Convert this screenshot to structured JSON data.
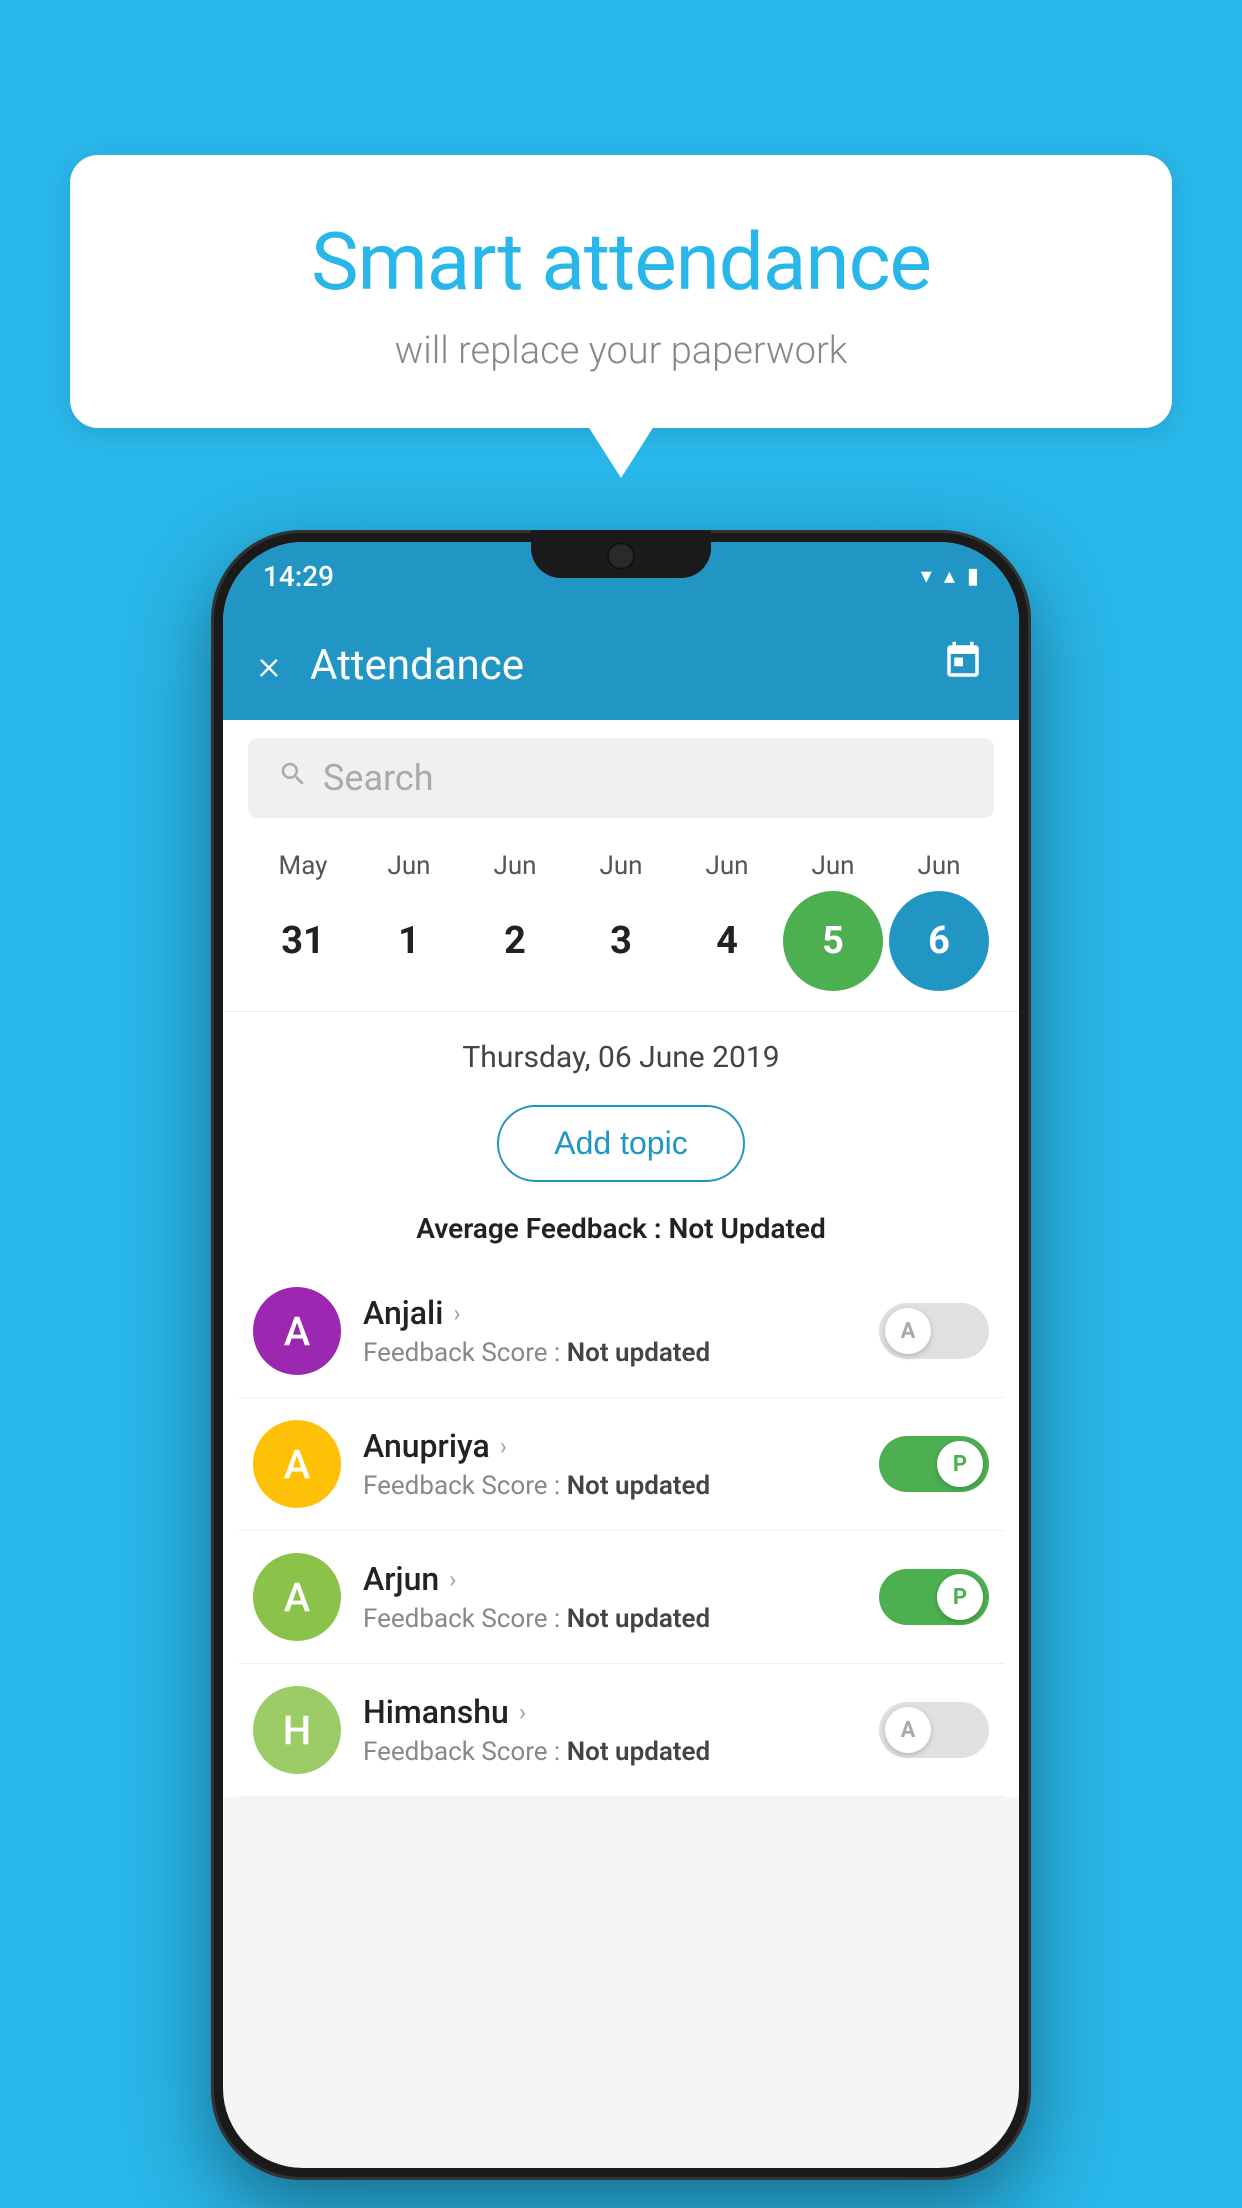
{
  "page": {
    "background_color": "#29b6e8"
  },
  "speech_bubble": {
    "headline": "Smart attendance",
    "subtext": "will replace your paperwork"
  },
  "status_bar": {
    "time": "14:29",
    "wifi_icon": "▼",
    "signal_icon": "▲",
    "battery_icon": "▮"
  },
  "app_bar": {
    "title": "Attendance",
    "close_label": "×",
    "calendar_icon": "📅"
  },
  "search": {
    "placeholder": "Search"
  },
  "calendar": {
    "dates": [
      {
        "month": "May",
        "day": "31",
        "state": "normal"
      },
      {
        "month": "Jun",
        "day": "1",
        "state": "normal"
      },
      {
        "month": "Jun",
        "day": "2",
        "state": "normal"
      },
      {
        "month": "Jun",
        "day": "3",
        "state": "normal"
      },
      {
        "month": "Jun",
        "day": "4",
        "state": "normal"
      },
      {
        "month": "Jun",
        "day": "5",
        "state": "today"
      },
      {
        "month": "Jun",
        "day": "6",
        "state": "selected"
      }
    ]
  },
  "selected_date": "Thursday, 06 June 2019",
  "add_topic_label": "Add topic",
  "avg_feedback": {
    "label": "Average Feedback : ",
    "value": "Not Updated"
  },
  "students": [
    {
      "name": "Anjali",
      "avatar_letter": "A",
      "avatar_color": "#9c27b0",
      "feedback_label": "Feedback Score : ",
      "feedback_value": "Not updated",
      "toggle_state": "off",
      "toggle_label": "A"
    },
    {
      "name": "Anupriya",
      "avatar_letter": "A",
      "avatar_color": "#ffc107",
      "feedback_label": "Feedback Score : ",
      "feedback_value": "Not updated",
      "toggle_state": "on",
      "toggle_label": "P"
    },
    {
      "name": "Arjun",
      "avatar_letter": "A",
      "avatar_color": "#8bc34a",
      "feedback_label": "Feedback Score : ",
      "feedback_value": "Not updated",
      "toggle_state": "on",
      "toggle_label": "P"
    },
    {
      "name": "Himanshu",
      "avatar_letter": "H",
      "avatar_color": "#9ccc65",
      "feedback_label": "Feedback Score : ",
      "feedback_value": "Not updated",
      "toggle_state": "off",
      "toggle_label": "A"
    }
  ]
}
